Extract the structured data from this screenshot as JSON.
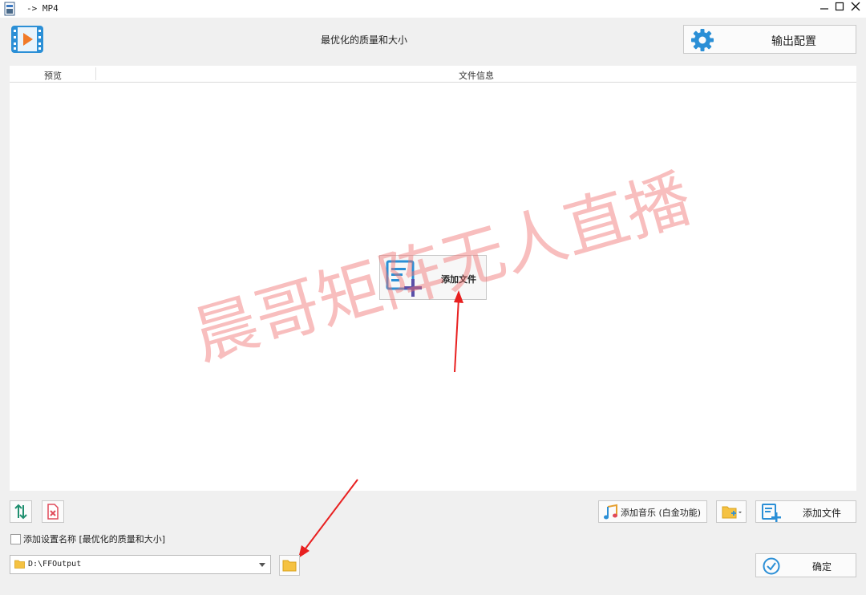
{
  "window": {
    "title": "-> MP4"
  },
  "header": {
    "preset_title": "最优化的质量和大小",
    "output_settings_label": "输出配置"
  },
  "table": {
    "columns": [
      "预览",
      "文件信息"
    ],
    "add_file_label": "添加文件"
  },
  "watermark": "晨哥矩阵无人直播",
  "toolbar": {
    "add_music_label": "添加音乐 (白金功能)",
    "add_file_label": "添加文件"
  },
  "options": {
    "add_setting_name_label": "添加设置名称 [最优化的质量和大小]",
    "add_setting_name_checked": false
  },
  "output": {
    "path": "D:\\FFOutput"
  },
  "actions": {
    "ok_label": "确定"
  },
  "colors": {
    "accent": "#2b8fd6",
    "arrow": "#e82020",
    "folder": "#f5c242"
  }
}
